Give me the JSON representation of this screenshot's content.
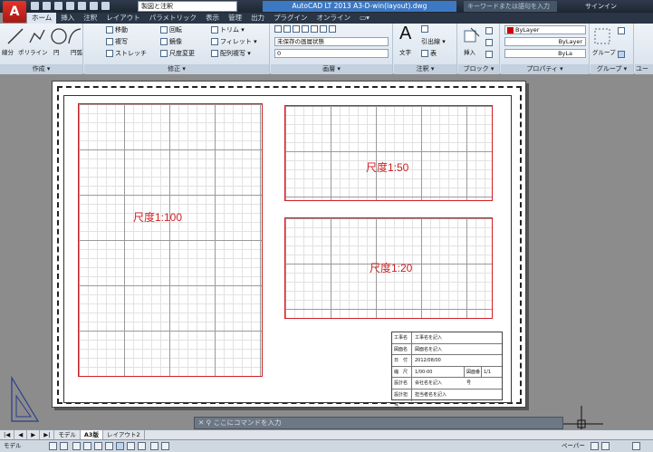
{
  "app": {
    "logo_letter": "A",
    "workspace": "製図と注釈",
    "window_title": "AutoCAD LT 2013   A3-D-win(layout).dwg",
    "search_placeholder": "キーワードまたは語句を入力",
    "signin": "サインイン"
  },
  "ribbon_tabs": [
    "ホーム",
    "挿入",
    "注釈",
    "レイアウト",
    "パラメトリック",
    "表示",
    "管理",
    "出力",
    "プラグイン",
    "オンライン",
    "▭▾"
  ],
  "ribbon": {
    "draw": {
      "title": "作成 ▾",
      "line": "線分",
      "polyline": "ポリライン",
      "circle": "円",
      "arc": "円弧"
    },
    "modify": {
      "title": "修正 ▾",
      "move": "移動",
      "rotate": "回転",
      "trim": "トリム ▾",
      "copy": "複写",
      "mirror": "鏡像",
      "fillet": "フィレット ▾",
      "stretch": "ストレッチ",
      "scale": "尺度変更",
      "array": "配列複写 ▾"
    },
    "layers": {
      "title": "画層 ▾",
      "state": "未保存の画層状態",
      "current": "0"
    },
    "annotation": {
      "title": "注釈 ▾",
      "text": "文字",
      "leader": "引出線 ▾",
      "table": "表"
    },
    "block": {
      "title": "ブロック ▾",
      "insert": "挿入"
    },
    "properties": {
      "title": "プロパティ ▾",
      "color": "ByLayer",
      "linetype": "ByLayer",
      "lineweight": "ByLa"
    },
    "groups": {
      "title": "グループ ▾",
      "group": "グループ"
    },
    "utilities": {
      "title": "ユーテ"
    }
  },
  "viewports": [
    {
      "label": "尺度1:100"
    },
    {
      "label": "尺度1:50"
    },
    {
      "label": "尺度1:20"
    }
  ],
  "title_block": {
    "rows": [
      {
        "key": "工事名",
        "value": "工事名を記入"
      },
      {
        "key": "図面名",
        "value": "図面名を記入"
      },
      {
        "key": "日　付",
        "value": "2012/08/00"
      },
      {
        "key": "縮　尺",
        "value": "1/00-00",
        "key2": "図面番号",
        "value2": "1/1"
      },
      {
        "key": "設計名",
        "value": "会社名を記入"
      },
      {
        "key": "設計担当",
        "value": "担当者名を記入"
      }
    ]
  },
  "command_line": {
    "placeholder": "ここにコマンドを入力"
  },
  "layout_tabs": [
    "|◀",
    "◀",
    "▶",
    "▶|",
    "モデル",
    "A3版",
    "レイアウト2"
  ],
  "status": {
    "coords": "モデル",
    "right": "ペーパー"
  }
}
